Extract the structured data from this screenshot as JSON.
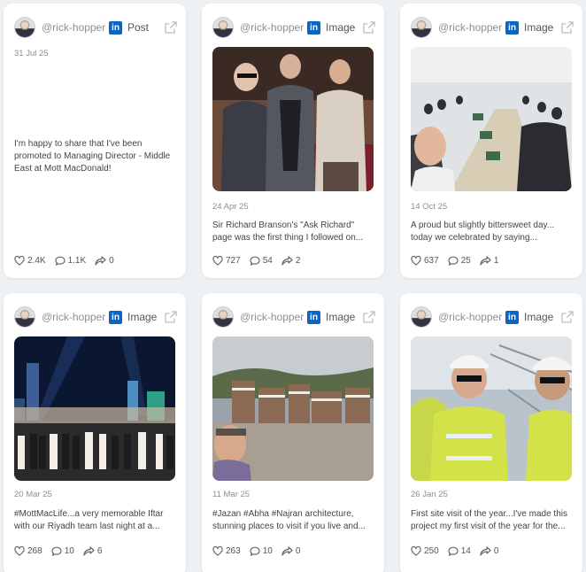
{
  "cards": [
    {
      "handle": "@rick-hopper",
      "type": "Post",
      "date": "31 Jul 25",
      "text": "I'm happy to share that I've been promoted to Managing Director - Middle East at Mott MacDonald!",
      "likes": "2.4K",
      "comments": "1.1K",
      "shares": "0"
    },
    {
      "handle": "@rick-hopper",
      "type": "Image",
      "date": "24 Apr 25",
      "text": "Sir Richard Branson's \"Ask Richard\" page was the first thing I followed on...",
      "likes": "727",
      "comments": "54",
      "shares": "2"
    },
    {
      "handle": "@rick-hopper",
      "type": "Image",
      "date": "14 Oct 25",
      "text": "A proud but slightly bittersweet day... today we celebrated by saying...",
      "likes": "637",
      "comments": "25",
      "shares": "1"
    },
    {
      "handle": "@rick-hopper",
      "type": "Image",
      "date": "20 Mar 25",
      "text": "#MottMacLife...a very memorable Iftar with our Riyadh team last night at a...",
      "likes": "268",
      "comments": "10",
      "shares": "6"
    },
    {
      "handle": "@rick-hopper",
      "type": "Image",
      "date": "11 Mar 25",
      "text": "#Jazan #Abha #Najran architecture, stunning places to visit if you live and...",
      "likes": "263",
      "comments": "10",
      "shares": "0"
    },
    {
      "handle": "@rick-hopper",
      "type": "Image",
      "date": "26 Jan 25",
      "text": "First site visit of the year...I've made this project my first visit of the year for the...",
      "likes": "250",
      "comments": "14",
      "shares": "0"
    }
  ],
  "icons": {
    "platform": "linkedin-icon",
    "open": "external-link-icon",
    "likes": "heart-icon",
    "comments": "comment-icon",
    "shares": "share-icon"
  },
  "colors": {
    "linkedin": "#0a66c2",
    "card": "#ffffff",
    "background": "#eef1f4"
  }
}
